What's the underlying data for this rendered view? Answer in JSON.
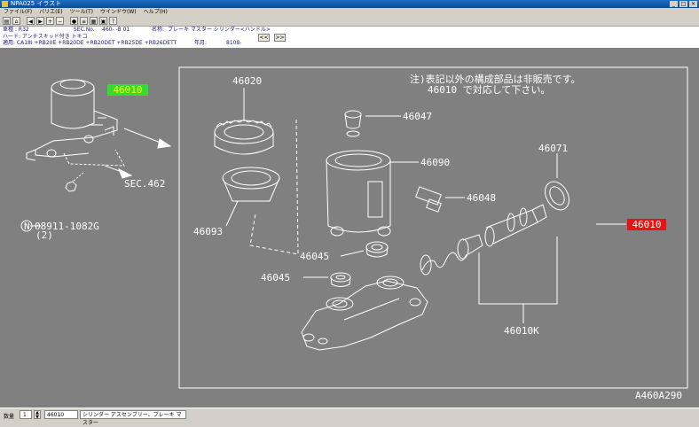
{
  "window": {
    "title": "NPA025 イラスト",
    "minimize": "_",
    "maximize": "□",
    "close": "×"
  },
  "menu": [
    "ファイル(F)",
    "バリエ(E)",
    "ツール(T)",
    "ウインドウ(W)",
    "ヘルプ(H)"
  ],
  "toolbar": {
    "buttons": [
      "print-icon",
      "home-icon",
      "back-icon",
      "forward-icon",
      "zoom-in-icon",
      "zoom-out-icon",
      "fit-icon",
      "list-icon",
      "grid-icon",
      "cart-icon",
      "help-icon"
    ]
  },
  "info": {
    "row1": {
      "model_label": "車種",
      "model_value": ": R32",
      "sec_label": "SEC.No.",
      "sec_value": "460- -B 01",
      "name_label": "名称:",
      "name_value": "ブレーキ マスター シリンダー<ハンドル>"
    },
    "row2": {
      "spec": "ハード: アンチスキッド付き トキコ"
    },
    "row3": {
      "apply": "適用: CA18I +RB20E +RB20DE +RB20DET +RB25DE +RB26DETT",
      "year_label": "年月:",
      "year_value": "8108-"
    },
    "prev_button": "<<",
    "next_button": ">>"
  },
  "diagram": {
    "note_line1": "注)表記以外の構成部品は非販売です。",
    "note_line2": "46010 で対応して下さい。",
    "labels": {
      "l46020": "46020",
      "l46047": "46047",
      "l46090": "46090",
      "l46071": "46071",
      "l46048": "46048",
      "l46093": "46093",
      "l46045a": "46045",
      "l46045b": "46045",
      "l46010K": "46010K",
      "sec462": "SEC.462",
      "bolt": "08911-1082G",
      "bolt_qty": "(2)",
      "bolt_circle": "N",
      "ref_code": "A460A290"
    },
    "highlight_green": "46010",
    "highlight_red": "46010"
  },
  "status": {
    "qty_label": "数量",
    "qty_value": "1",
    "part_no": "46010",
    "part_name": "シリンダー アスセンブリー、ブレーキ マスター"
  }
}
